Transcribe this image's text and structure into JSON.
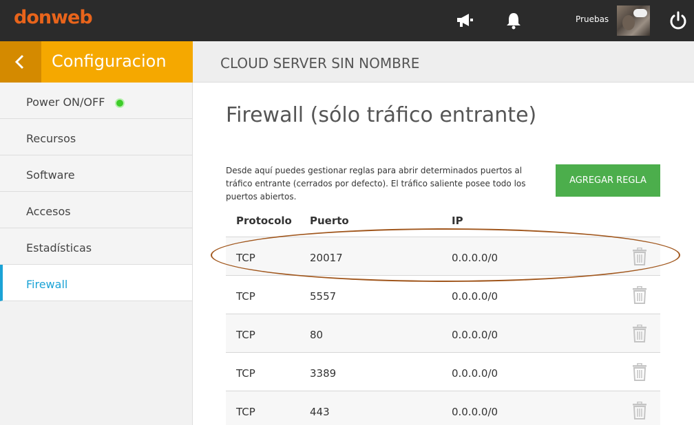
{
  "topbar": {
    "logo": "donweb",
    "user_name": "Pruebas",
    "icons": [
      "megaphone-icon",
      "bell-icon",
      "power-icon"
    ]
  },
  "panel": {
    "title": "Configuracion",
    "back_icon": "chevron-left-icon"
  },
  "sidebar": {
    "items": [
      {
        "label": "Power ON/OFF",
        "status": "on",
        "status_color": "#3ecc29"
      },
      {
        "label": "Recursos"
      },
      {
        "label": "Software"
      },
      {
        "label": "Accesos"
      },
      {
        "label": "Estadísticas"
      },
      {
        "label": "Firewall",
        "active": true
      }
    ]
  },
  "header": {
    "server_name": "CLOUD SERVER SIN NOMBRE"
  },
  "main": {
    "title": "Firewall (sólo tráfico entrante)",
    "description": "Desde aquí puedes gestionar reglas para abrir determinados puertos al tráfico entrante (cerrados por defecto). El tráfico saliente posee todo los puertos abiertos.",
    "add_button": "AGREGAR REGLA",
    "table": {
      "columns": [
        "Protocolo",
        "Puerto",
        "IP"
      ],
      "rows": [
        {
          "protocol": "TCP",
          "port": "20017",
          "ip": "0.0.0.0/0"
        },
        {
          "protocol": "TCP",
          "port": "5557",
          "ip": "0.0.0.0/0"
        },
        {
          "protocol": "TCP",
          "port": "80",
          "ip": "0.0.0.0/0"
        },
        {
          "protocol": "TCP",
          "port": "3389",
          "ip": "0.0.0.0/0"
        },
        {
          "protocol": "TCP",
          "port": "443",
          "ip": "0.0.0.0/0"
        }
      ]
    }
  },
  "colors": {
    "brand": "#e8641b",
    "panel_header": "#f5a800",
    "active": "#1ba3d6",
    "add_button": "#4cae4c",
    "highlight": "#a0561c"
  }
}
